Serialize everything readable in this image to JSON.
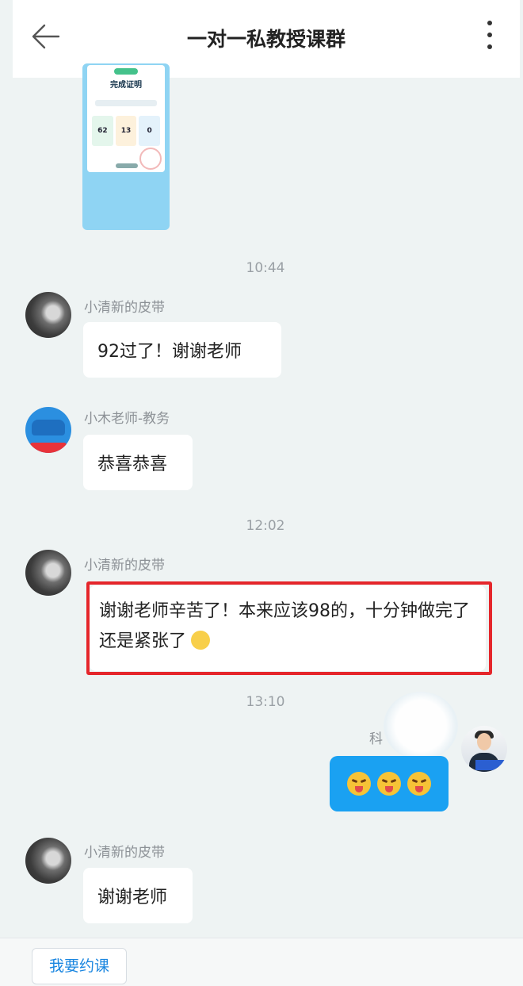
{
  "header": {
    "title": "一对一私教授课群"
  },
  "image_card": {
    "heading": "完成证明",
    "stats": [
      "62",
      "13",
      "0"
    ]
  },
  "timestamps": [
    "10:44",
    "12:02",
    "13:10"
  ],
  "messages": [
    {
      "sender": "小清新的皮带",
      "text": "92过了！谢谢老师"
    },
    {
      "sender": "小木老师-教务",
      "text": "恭喜恭喜"
    },
    {
      "sender": "小清新的皮带",
      "text": "谢谢老师辛苦了！本来应该98的，十分钟做完了还是紧张了"
    },
    {
      "sender": "科",
      "text": ""
    },
    {
      "sender": "小清新的皮带",
      "text": "谢谢老师"
    }
  ],
  "footer": {
    "book_button": "我要约课"
  }
}
